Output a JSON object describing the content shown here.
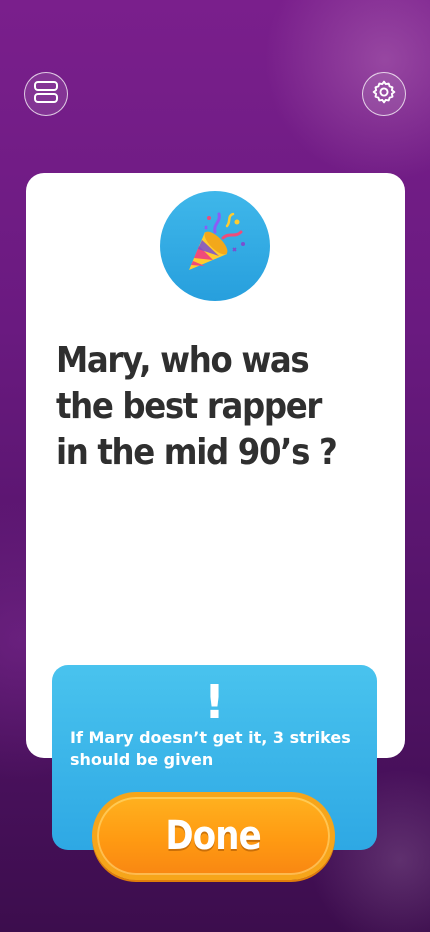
{
  "header": {
    "menu_icon": "layers-icon",
    "settings_icon": "gear-icon"
  },
  "card": {
    "emoji_icon": "party-popper-icon",
    "question": "Mary, who was the best rapper in the mid 90’s ?"
  },
  "info": {
    "icon": "exclamation-icon",
    "symbol": "!",
    "text": "If Mary doesn’t get it, 3 strikes should be given"
  },
  "actions": {
    "done_label": "Done"
  },
  "colors": {
    "background": "#6a1a80",
    "card": "#ffffff",
    "info_box": "#3bb6ea",
    "done_button": "#ff9a12",
    "question_text": "#2f2f2f"
  }
}
